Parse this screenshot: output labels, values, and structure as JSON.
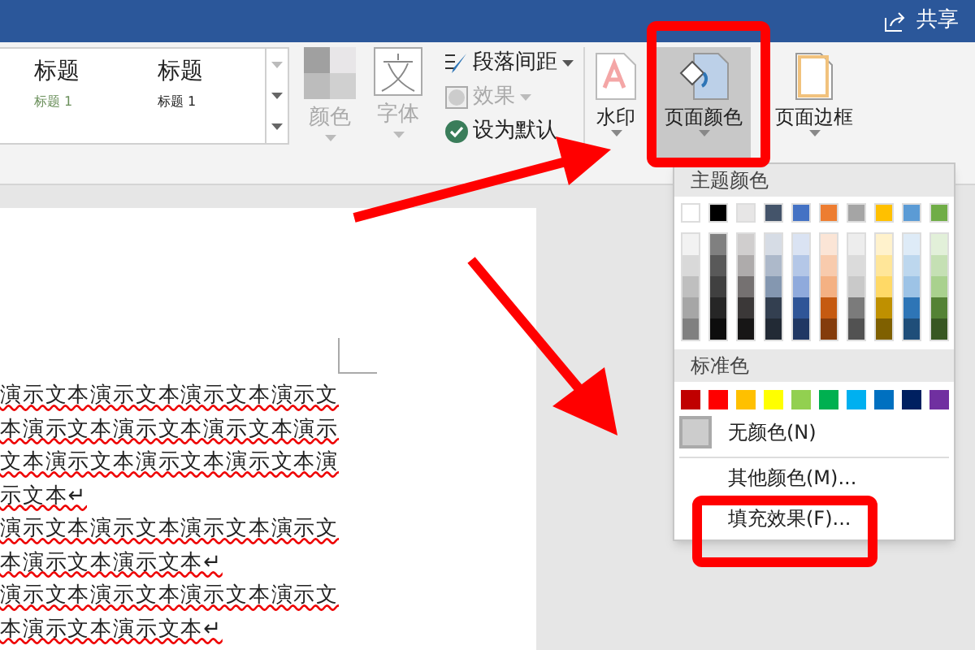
{
  "title_bar": {
    "share": "共享"
  },
  "ribbon": {
    "styles": [
      {
        "title": "标题",
        "subtitle": "标题 1",
        "color": "#6a8f5a"
      },
      {
        "title": "标题",
        "subtitle": "标题 1",
        "color": "#222222"
      }
    ],
    "colors_button": {
      "label": "颜色",
      "disabled": true
    },
    "fonts_button": {
      "label": "字体",
      "disabled": true
    },
    "paragraph_spacing": {
      "label": "段落间距",
      "disabled": false
    },
    "effects": {
      "label": "效果",
      "disabled": true
    },
    "set_default": {
      "label": "设为默认",
      "disabled": false
    },
    "watermark": {
      "label": "水印",
      "selected": false
    },
    "page_color": {
      "label": "页面颜色",
      "selected": true
    },
    "page_borders": {
      "label": "页面边框",
      "selected": false
    }
  },
  "document": {
    "lines": [
      "演示文本演示文本演示文本演示文",
      "本演示文本演示文本演示文本演示",
      "文本演示文本演示文本演示文本演",
      "示文本↵",
      "演示文本演示文本演示文本演示文",
      "本演示文本演示文本↵",
      "演示文本演示文本演示文本演示文",
      "本演示文本演示文本↵"
    ]
  },
  "color_menu": {
    "theme_header": "主题颜色",
    "theme_colors": [
      {
        "color": "#ffffff",
        "shades": [
          {
            "color": "#f2f2f2"
          },
          {
            "color": "#d9d9d9"
          },
          {
            "color": "#bfbfbf"
          },
          {
            "color": "#a6a6a6"
          },
          {
            "color": "#808080"
          }
        ]
      },
      {
        "color": "#000000",
        "shades": [
          {
            "color": "#808080"
          },
          {
            "color": "#595959"
          },
          {
            "color": "#404040"
          },
          {
            "color": "#262626"
          },
          {
            "color": "#0d0d0d"
          }
        ]
      },
      {
        "color": "#e7e6e6",
        "shades": [
          {
            "color": "#d0cece"
          },
          {
            "color": "#aeabab"
          },
          {
            "color": "#757171"
          },
          {
            "color": "#3b3838"
          },
          {
            "color": "#171616"
          }
        ]
      },
      {
        "color": "#44546a",
        "shades": [
          {
            "color": "#d6dce5"
          },
          {
            "color": "#adb9ca"
          },
          {
            "color": "#8497b0"
          },
          {
            "color": "#333f50"
          },
          {
            "color": "#222a35"
          }
        ]
      },
      {
        "color": "#4472c4",
        "shades": [
          {
            "color": "#dae3f3"
          },
          {
            "color": "#b4c7e7"
          },
          {
            "color": "#8faadc"
          },
          {
            "color": "#2f5597"
          },
          {
            "color": "#203864"
          }
        ]
      },
      {
        "color": "#ed7d31",
        "shades": [
          {
            "color": "#fbe5d6"
          },
          {
            "color": "#f8cbad"
          },
          {
            "color": "#f4b183"
          },
          {
            "color": "#c55a11"
          },
          {
            "color": "#843c0c"
          }
        ]
      },
      {
        "color": "#a5a5a5",
        "shades": [
          {
            "color": "#ededed"
          },
          {
            "color": "#dbdbdb"
          },
          {
            "color": "#c9c9c9"
          },
          {
            "color": "#7b7b7b"
          },
          {
            "color": "#525252"
          }
        ]
      },
      {
        "color": "#ffc000",
        "shades": [
          {
            "color": "#fff2cc"
          },
          {
            "color": "#ffe699"
          },
          {
            "color": "#ffd966"
          },
          {
            "color": "#bf9000"
          },
          {
            "color": "#7f6000"
          }
        ]
      },
      {
        "color": "#5b9bd5",
        "shades": [
          {
            "color": "#deebf7"
          },
          {
            "color": "#bdd7ee"
          },
          {
            "color": "#9dc3e6"
          },
          {
            "color": "#2e75b6"
          },
          {
            "color": "#1f4e79"
          }
        ]
      },
      {
        "color": "#70ad47",
        "shades": [
          {
            "color": "#e2f0d9"
          },
          {
            "color": "#c5e0b4"
          },
          {
            "color": "#a9d18e"
          },
          {
            "color": "#548235"
          },
          {
            "color": "#385723"
          }
        ]
      }
    ],
    "standard_header": "标准色",
    "standard_colors": [
      {
        "color": "#c00000"
      },
      {
        "color": "#ff0000"
      },
      {
        "color": "#ffc000"
      },
      {
        "color": "#ffff00"
      },
      {
        "color": "#92d050"
      },
      {
        "color": "#00b050"
      },
      {
        "color": "#00b0f0"
      },
      {
        "color": "#0070c0"
      },
      {
        "color": "#002060"
      },
      {
        "color": "#7030a0"
      }
    ],
    "no_color": "无颜色(N)",
    "items": [
      "其他颜色(M)...",
      "填充效果(F)..."
    ]
  }
}
